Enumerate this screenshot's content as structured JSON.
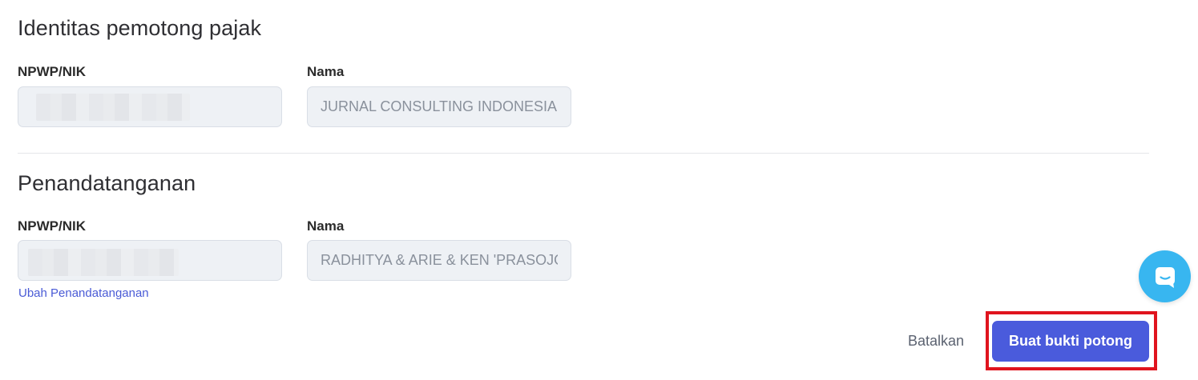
{
  "withholder": {
    "title": "Identitas pemotong pajak",
    "npwp_label": "NPWP/NIK",
    "name_label": "Nama",
    "name_value": "JURNAL CONSULTING INDONESIA"
  },
  "signer": {
    "title": "Penandatanganan",
    "npwp_label": "NPWP/NIK",
    "name_label": "Nama",
    "name_value": "RADHITYA & ARIE & KEN 'PRASOJO",
    "change_link": "Ubah Penandatanganan"
  },
  "actions": {
    "cancel_label": "Batalkan",
    "submit_label": "Buat bukti potong"
  },
  "chat": {
    "icon": "chat-icon"
  },
  "colors": {
    "primary": "#4a5bdc",
    "link": "#4a5bd6",
    "chat": "#38b6f0",
    "highlight": "#e0141e"
  }
}
